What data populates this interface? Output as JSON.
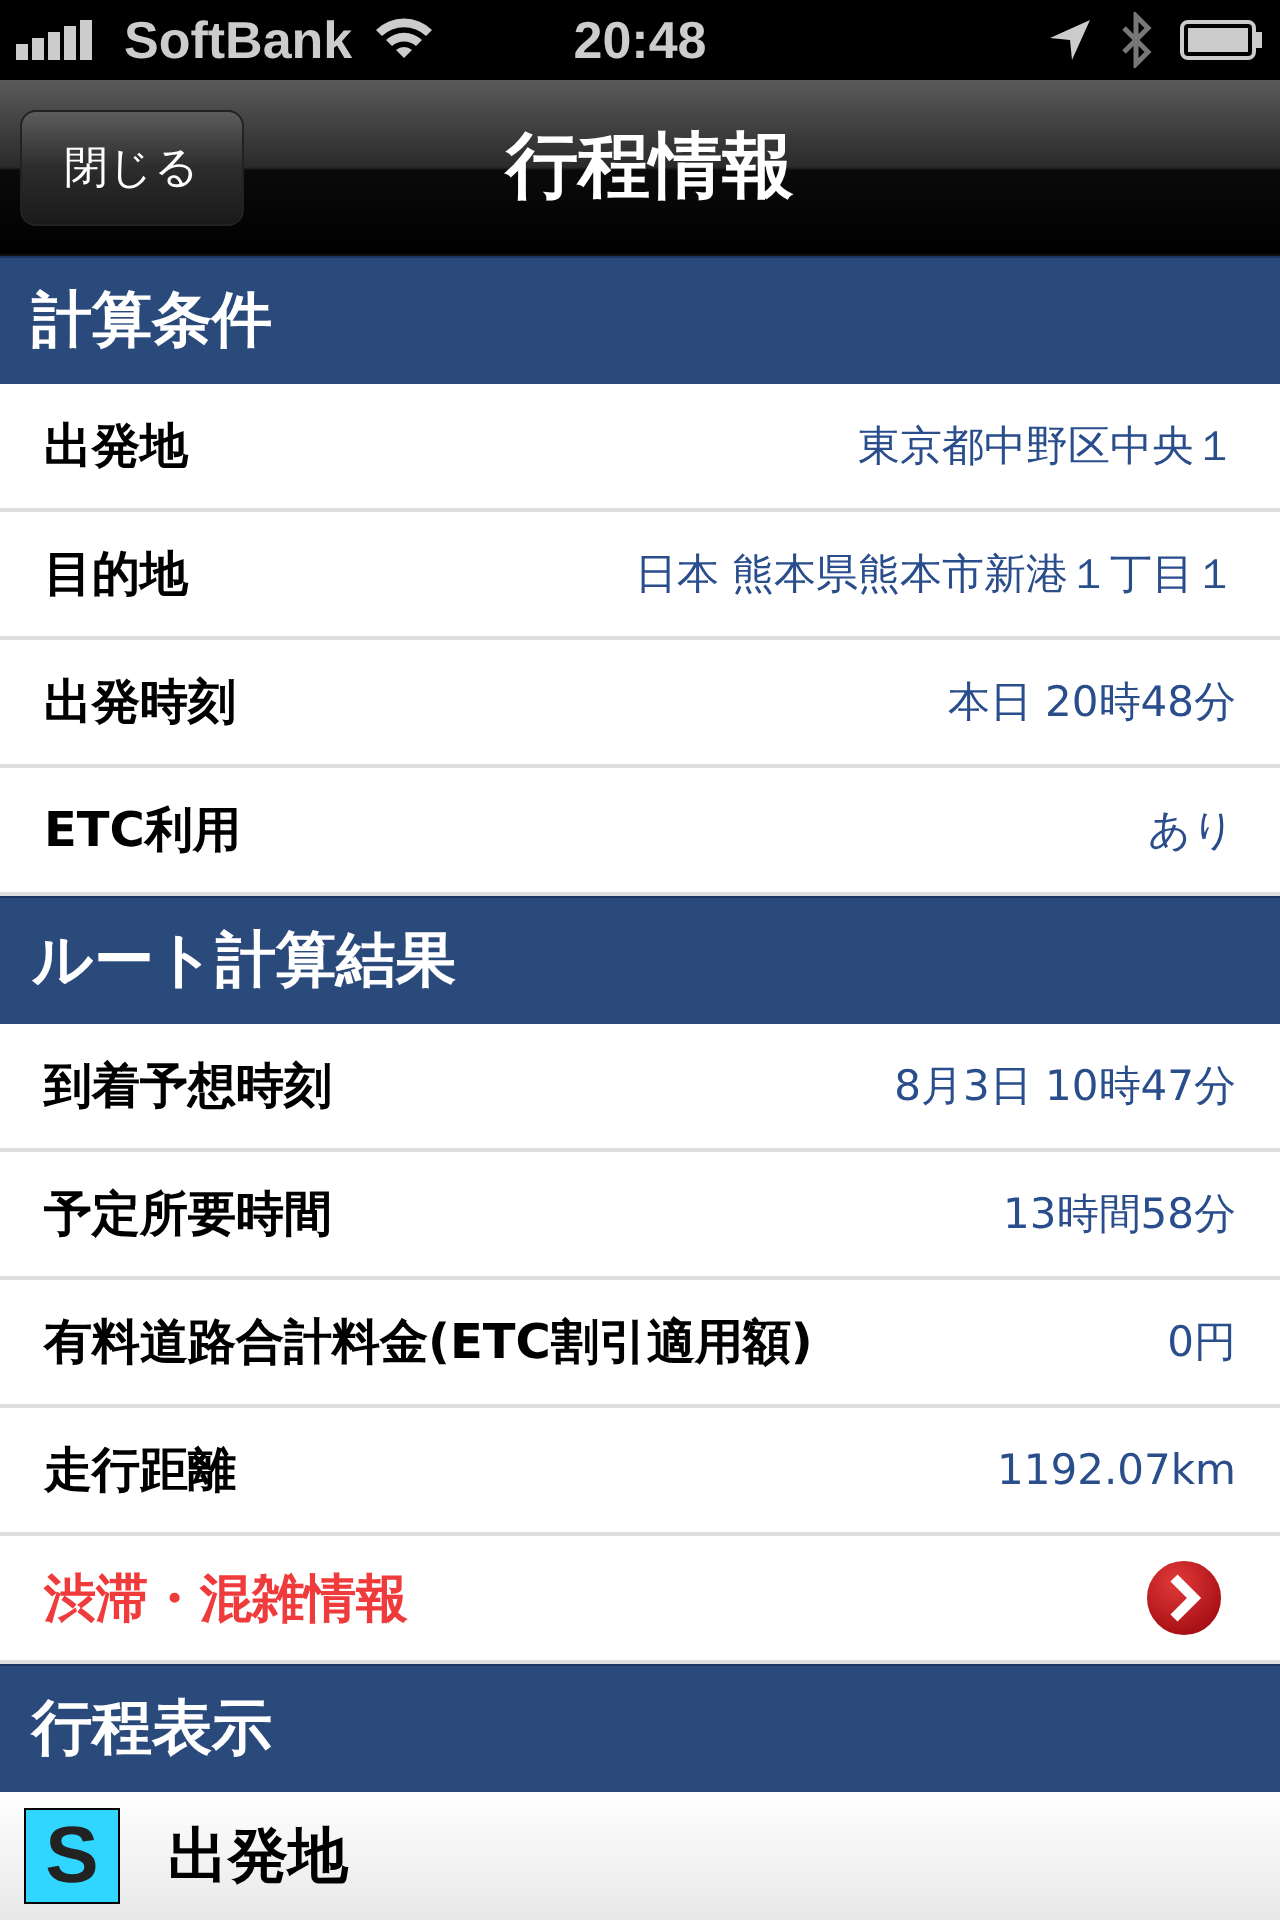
{
  "status_bar": {
    "carrier": "SoftBank",
    "time": "20:48"
  },
  "nav_bar": {
    "back_button": "閉じる",
    "title": "行程情報"
  },
  "sections": [
    {
      "title": "計算条件",
      "rows": [
        {
          "kind": "value",
          "label": "出発地",
          "value": "東京都中野区中央１"
        },
        {
          "kind": "value",
          "label": "目的地",
          "value": "日本 熊本県熊本市新港１丁目１"
        },
        {
          "kind": "value",
          "label": "出発時刻",
          "value": "本日 20時48分"
        },
        {
          "kind": "value",
          "label": "ETC利用",
          "value": "あり"
        }
      ]
    },
    {
      "title": "ルート計算結果",
      "rows": [
        {
          "kind": "value",
          "label": "到着予想時刻",
          "value": "8月3日 10時47分"
        },
        {
          "kind": "value",
          "label": "予定所要時間",
          "value": "13時間58分"
        },
        {
          "kind": "value",
          "label": "有料道路合計料金(ETC割引適用額)",
          "value": "0円"
        },
        {
          "kind": "value",
          "label": "走行距離",
          "value": "1192.07km"
        },
        {
          "kind": "link",
          "label": "渋滞・混雑情報"
        }
      ]
    },
    {
      "title": "行程表示",
      "rows": [
        {
          "kind": "stop",
          "marker": "S",
          "label": "出発地"
        }
      ]
    }
  ]
}
